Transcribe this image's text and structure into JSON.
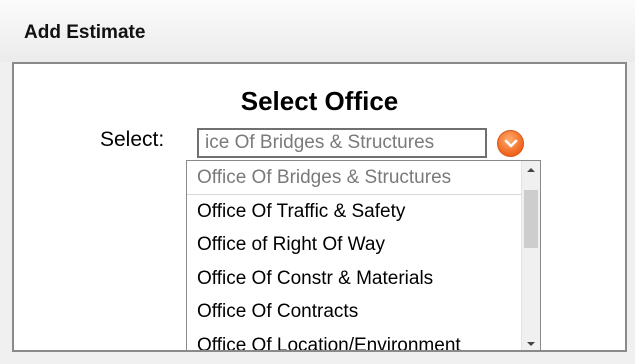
{
  "dialog": {
    "title": "Add Estimate"
  },
  "panel": {
    "title": "Select Office",
    "select_label": "Select:",
    "select_value": "ice Of Bridges & Structures"
  },
  "dropdown": {
    "options": [
      "Office Of Bridges & Structures",
      "Office Of Traffic & Safety",
      "Office of Right Of Way",
      "Office Of Constr & Materials",
      "Office Of Contracts",
      "Office Of Location/Environment"
    ],
    "selected_index": 0
  },
  "colors": {
    "toggle_accent": "#f0631d",
    "panel_border": "#8a8a8a",
    "selected_text": "#7a7a7a"
  }
}
